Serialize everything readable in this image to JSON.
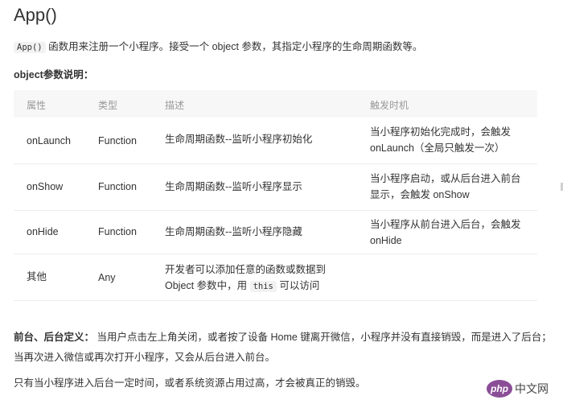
{
  "page": {
    "title": "App()",
    "intro_code": "App()",
    "intro_text": "函数用来注册一个小程序。接受一个 object 参数，其指定小程序的生命周期函数等。",
    "params_heading": "object参数说明："
  },
  "table": {
    "headers": [
      "属性",
      "类型",
      "描述",
      "触发时机"
    ],
    "rows": [
      {
        "name": "onLaunch",
        "type": "Function",
        "desc": "生命周期函数--监听小程序初始化",
        "trigger_1": "当小程序初始化完成时，会触发",
        "trigger_2": "onLaunch（全局只触发一次）"
      },
      {
        "name": "onShow",
        "type": "Function",
        "desc": "生命周期函数--监听小程序显示",
        "trigger_1": "当小程序启动，或从后台进入前台",
        "trigger_2": "显示，会触发 onShow"
      },
      {
        "name": "onHide",
        "type": "Function",
        "desc": "生命周期函数--监听小程序隐藏",
        "trigger_1": "当小程序从前台进入后台，会触发",
        "trigger_2": "onHide"
      },
      {
        "name": "其他",
        "type": "Any",
        "desc_1": "开发者可以添加任意的函数或数据到",
        "desc_2_pre": "Object 参数中，用",
        "desc_2_code": "this",
        "desc_2_post": "可以访问"
      }
    ]
  },
  "notes": {
    "bg_label": "前台、后台定义：",
    "bg_text_1": "当用户点击左上角关闭，或者按了设备 Home 键离开微信，小程序并没有直接销毁，而是进入了后台；",
    "bg_text_2": "当再次进入微信或再次打开小程序，又会从后台进入前台。",
    "destroy_text": "只有当小程序进入后台一定时间，或者系统资源占用过高，才会被真正的销毁。"
  },
  "watermark": {
    "brand": "php",
    "site": "中文网",
    "brand_color": "#8a4e96"
  }
}
